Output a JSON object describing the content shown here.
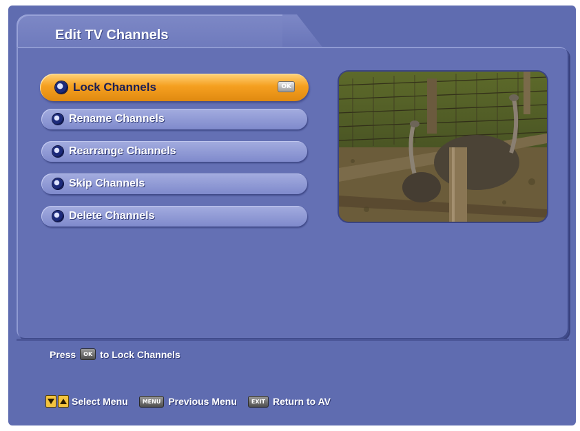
{
  "header": {
    "title": "Edit TV Channels"
  },
  "menu": {
    "items": [
      {
        "label": "Lock Channels",
        "selected": true
      },
      {
        "label": "Rename Channels",
        "selected": false
      },
      {
        "label": "Rearrange Channels",
        "selected": false
      },
      {
        "label": "Skip Channels",
        "selected": false
      },
      {
        "label": "Delete Channels",
        "selected": false
      }
    ],
    "ok_key": "OK"
  },
  "hint": {
    "prefix": "Press",
    "key": "OK",
    "suffix": "to Lock Channels"
  },
  "footer": {
    "select_label": "Select Menu",
    "menu_key": "MENU",
    "previous_label": "Previous Menu",
    "exit_key": "EXIT",
    "return_label": "Return to AV"
  },
  "icons": {
    "bullet": "bullet-icon",
    "down": "arrow-down-icon",
    "up": "arrow-up-icon"
  },
  "colors": {
    "background": "#5f6cb0",
    "selected_item": "#f5a020",
    "item": "#8f99d6"
  }
}
